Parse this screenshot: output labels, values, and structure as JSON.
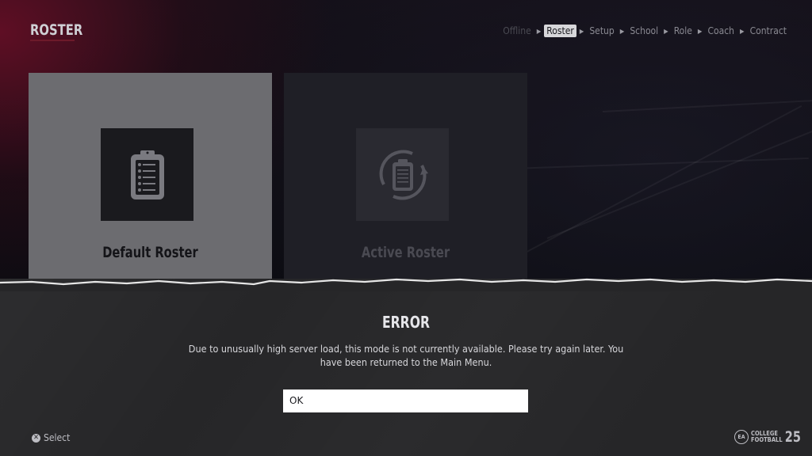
{
  "header": {
    "title": "ROSTER",
    "breadcrumb": [
      "Offline",
      "Roster",
      "Setup",
      "School",
      "Role",
      "Coach",
      "Contract"
    ],
    "breadcrumb_active": "Roster"
  },
  "cards": [
    {
      "label": "Default Roster",
      "icon": "clipboard-icon",
      "state": "selected"
    },
    {
      "label": "Active Roster",
      "icon": "clipboard-refresh-icon",
      "state": "disabled"
    }
  ],
  "dialog": {
    "title": "ERROR",
    "message": "Due to unusually high server load, this mode is not currently available.  Please try again later.  You have been returned to the Main Menu.",
    "ok_label": "OK"
  },
  "footer": {
    "select_icon": "cross-button-icon",
    "select_label": "Select",
    "logo_ea": "EA",
    "logo_line1": "COLLEGE",
    "logo_line2": "FOOTBALL",
    "logo_year": "25"
  },
  "colors": {
    "accent_red": "#6d1a2a",
    "card_selected": "#6c6c70",
    "card_disabled": "#1f1f26",
    "dialog_bg": "#262628",
    "button_bg": "#ffffff"
  }
}
